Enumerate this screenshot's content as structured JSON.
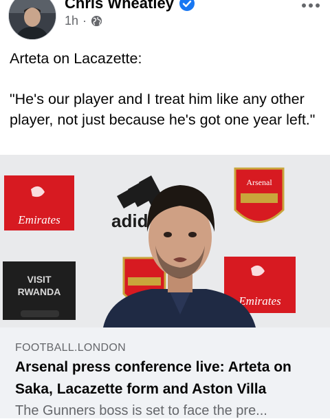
{
  "post": {
    "author": "Chris Wheatley",
    "time": "1h",
    "separator": "·",
    "text_line1": "Arteta on Lacazette:",
    "quote": "\"He's our player and I treat him like any other player, not just because he's got one year left.\""
  },
  "photo": {
    "board_left": "Emirates",
    "board_right": "Emirates",
    "visit_line1": "VISIT",
    "visit_line2": "RWANDA",
    "brand": "adidas",
    "crest_text": "Arsenal"
  },
  "link": {
    "domain": "FOOTBALL.LONDON",
    "headline": "Arsenal press conference live: Arteta on Saka, Lacazette form and Aston Villa",
    "description": "The Gunners boss is set to face the pre..."
  },
  "colors": {
    "verified": "#1877f2",
    "secondary_text": "#65676b",
    "card_bg": "#f0f2f5",
    "emirates_red": "#d71a21"
  },
  "icons": [
    "verified-badge-icon",
    "globe-icon",
    "more-options-icon"
  ]
}
